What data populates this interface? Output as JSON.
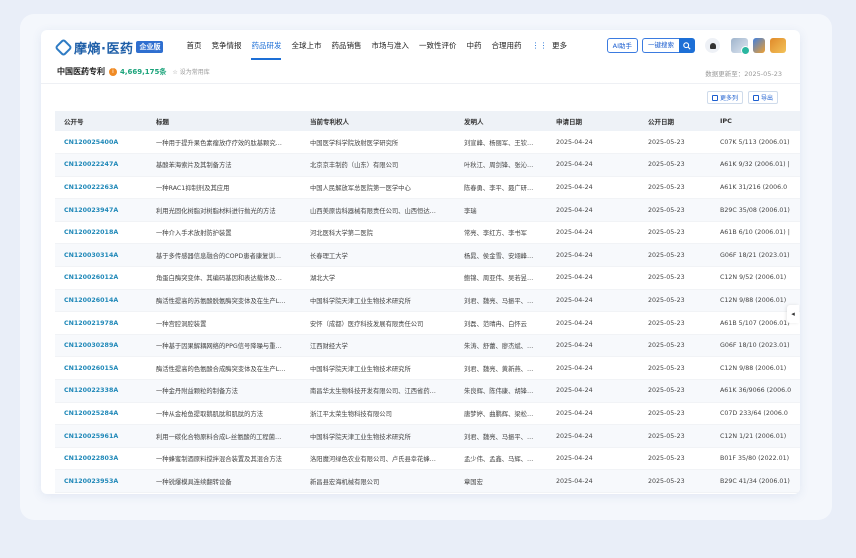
{
  "app": {
    "logo_text": "摩熵·医药",
    "logo_badge": "企业版"
  },
  "nav": {
    "items": [
      "首页",
      "竞争情报",
      "药品研发",
      "全球上市",
      "药品销售",
      "市场与准入",
      "一致性评价",
      "中药",
      "合理用药",
      "更多"
    ],
    "active": "药品研发"
  },
  "toolbar": {
    "ai_label": "AI助手",
    "search_label": "一键搜索"
  },
  "header": {
    "db_title": "中国医药专利",
    "count": "4,669,175条",
    "set_common": "设为常用库",
    "update_date": "数据更新至：2025-05-23",
    "cols_button": "更多列",
    "export_button": "导出"
  },
  "table": {
    "columns": [
      "公开号",
      "标题",
      "当前专利权人",
      "发明人",
      "申请日期",
      "公开日期",
      "IPC"
    ],
    "rows": [
      [
        "CN120025400A",
        "一种用于提升果色素瘤放疗疗效的肽基颗究…",
        "中国医学科学院放射医学研究所",
        "刘宣峰、杨丽军、王钦…",
        "2025-04-24",
        "2025-05-23",
        "C07K 5/113 (2006.01)"
      ],
      [
        "CN120022247A",
        "基酸苯海索片及其制备方法",
        "北京京丰制药（山东）有限公司",
        "叶秋江、周剑锋、张沁…",
        "2025-04-24",
        "2025-05-23",
        "A61K 9/32 (2006.01) |"
      ],
      [
        "CN120022263A",
        "一种RAC1抑制剂及其应用",
        "中国人民解放军总医院第一医学中心",
        "陈春勇、李平、聂广研…",
        "2025-04-24",
        "2025-05-23",
        "A61K 31/216 (2006.0"
      ],
      [
        "CN120023947A",
        "利用光固化树脂对树脂材料进行抛光的方法",
        "山西美原齿科器械有限责任公司、山西恒达…",
        "李瑞",
        "2025-04-24",
        "2025-05-23",
        "B29C 35/08 (2006.01)"
      ],
      [
        "CN120022018A",
        "一种介入手术放射防护装置",
        "河北医科大学第二医院",
        "常亮、李红方、李书军",
        "2025-04-24",
        "2025-05-23",
        "A61B 6/10 (2006.01) |"
      ],
      [
        "CN120030314A",
        "基于多传感器信息融合的COPD患者康复训…",
        "长春理工大学",
        "杨晁、侯金雪、安翊峰…",
        "2025-04-24",
        "2025-05-23",
        "G06F 18/21 (2023.01)"
      ],
      [
        "CN120026012A",
        "角蛋白酶突变体、其编码基因和表达载体及…",
        "湖北大学",
        "鲍锦、周亚伟、吴若昱…",
        "2025-04-24",
        "2025-05-23",
        "C12N 9/52 (2006.01)"
      ],
      [
        "CN120026014A",
        "酶活性提高的苏氨酸脱氨酶突变体及在生产L…",
        "中国科学院天津工业生物技术研究所",
        "刘君、魏亮、马振平、…",
        "2025-04-24",
        "2025-05-23",
        "C12N 9/88 (2006.01)"
      ],
      [
        "CN120021978A",
        "一种宫腔洞腔装置",
        "安怀（成都）医疗科技发展有限责任公司",
        "刘磊、范晴冉、白怀云",
        "2025-04-24",
        "2025-05-23",
        "A61B 5/107 (2006.01)"
      ],
      [
        "CN120030289A",
        "一种基于因果解耦网络的PPG信号降噪与重…",
        "江西财经大学",
        "朱涛、舒蕾、廖杰斌、…",
        "2025-04-24",
        "2025-05-23",
        "G06F 18/10 (2023.01)"
      ],
      [
        "CN120026015A",
        "酶活性提高的色氨酸合成酶突变体及在生产L…",
        "中国科学院天津工业生物技术研究所",
        "刘君、魏亮、黄新燕、…",
        "2025-04-24",
        "2025-05-23",
        "C12N 9/88 (2006.01)"
      ],
      [
        "CN120022338A",
        "一种金丹附益颗粒的制备方法",
        "南昌华太生物科技开发有限公司、江西省药…",
        "朱良辉、陈伟康、胡锋…",
        "2025-04-24",
        "2025-05-23",
        "A61K 36/9066 (2006.0"
      ],
      [
        "CN120025284A",
        "一种从金枪鱼提取鹅肌肽和肌肽的方法",
        "浙江平太荣生物科技有限公司",
        "唐梦婷、曲鹏辉、梁松…",
        "2025-04-24",
        "2025-05-23",
        "C07D 233/64 (2006.0"
      ],
      [
        "CN120025961A",
        "利用一碳化合物原料合成L-丝氨酸的工程菌…",
        "中国科学院天津工业生物技术研究所",
        "刘君、魏亮、马振平、…",
        "2025-04-24",
        "2025-05-23",
        "C12N 1/21 (2006.01)"
      ],
      [
        "CN120022803A",
        "一种蜂蜜制酒原料搅拌混合装置及其混合方法",
        "洛阳魔河绿色农业有限公司、卢氏县幸花蜂…",
        "孟少伟、孟鑫、马辉、…",
        "2025-04-24",
        "2025-05-23",
        "B01F 35/80 (2022.01)"
      ],
      [
        "CN120023953A",
        "一种锐爆模具连续翻转设备",
        "新昌县宏海机械有限公司",
        "章国宏",
        "2025-04-24",
        "2025-05-23",
        "B29C 41/34 (2006.01)"
      ]
    ]
  }
}
